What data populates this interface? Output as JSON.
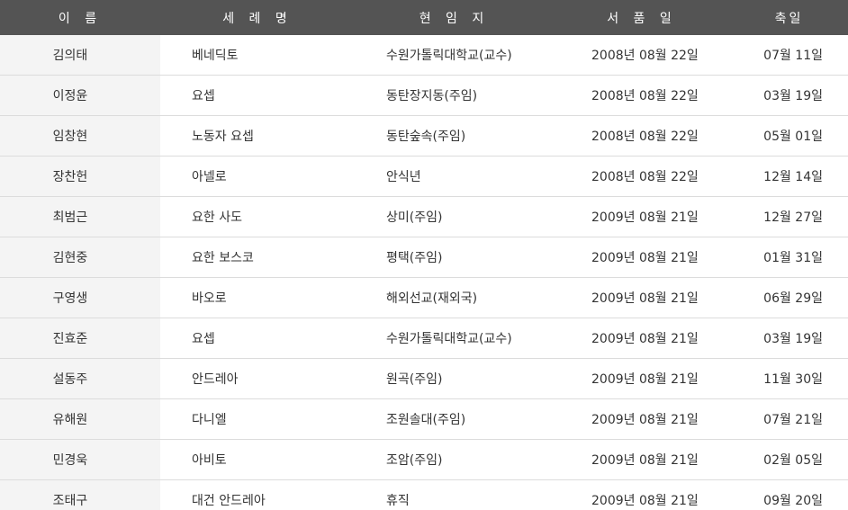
{
  "header": {
    "name": "이 름",
    "baptismal_name": "세 례 명",
    "current_post": "현 임 지",
    "ordination_date": "서 품 일",
    "feast_day": "축일"
  },
  "rows": [
    {
      "name": "김의태",
      "baptismal_name": "베네딕토",
      "current_post": "수원가톨릭대학교(교수)",
      "ordination_date": "2008년 08월 22일",
      "feast_day": "07월 11일"
    },
    {
      "name": "이정윤",
      "baptismal_name": "요셉",
      "current_post": "동탄장지동(주임)",
      "ordination_date": "2008년 08월 22일",
      "feast_day": "03월 19일"
    },
    {
      "name": "임창현",
      "baptismal_name": "노동자 요셉",
      "current_post": "동탄숲속(주임)",
      "ordination_date": "2008년 08월 22일",
      "feast_day": "05월 01일"
    },
    {
      "name": "장찬헌",
      "baptismal_name": "아넬로",
      "current_post": "안식년",
      "ordination_date": "2008년 08월 22일",
      "feast_day": "12월 14일"
    },
    {
      "name": "최범근",
      "baptismal_name": "요한 사도",
      "current_post": "상미(주임)",
      "ordination_date": "2009년 08월 21일",
      "feast_day": "12월 27일"
    },
    {
      "name": "김현중",
      "baptismal_name": "요한 보스코",
      "current_post": "평택(주임)",
      "ordination_date": "2009년 08월 21일",
      "feast_day": "01월 31일"
    },
    {
      "name": "구영생",
      "baptismal_name": "바오로",
      "current_post": "해외선교(재외국)",
      "ordination_date": "2009년 08월 21일",
      "feast_day": "06월 29일"
    },
    {
      "name": "진효준",
      "baptismal_name": "요셉",
      "current_post": "수원가톨릭대학교(교수)",
      "ordination_date": "2009년 08월 21일",
      "feast_day": "03월 19일"
    },
    {
      "name": "설동주",
      "baptismal_name": "안드레아",
      "current_post": "원곡(주임)",
      "ordination_date": "2009년 08월 21일",
      "feast_day": "11월 30일"
    },
    {
      "name": "유해원",
      "baptismal_name": "다니엘",
      "current_post": "조원솔대(주임)",
      "ordination_date": "2009년 08월 21일",
      "feast_day": "07월 21일"
    },
    {
      "name": "민경욱",
      "baptismal_name": "아비토",
      "current_post": "조암(주임)",
      "ordination_date": "2009년 08월 21일",
      "feast_day": "02월 05일"
    },
    {
      "name": "조태구",
      "baptismal_name": "대건 안드레아",
      "current_post": "휴직",
      "ordination_date": "2009년 08월 21일",
      "feast_day": "09월 20일"
    }
  ]
}
